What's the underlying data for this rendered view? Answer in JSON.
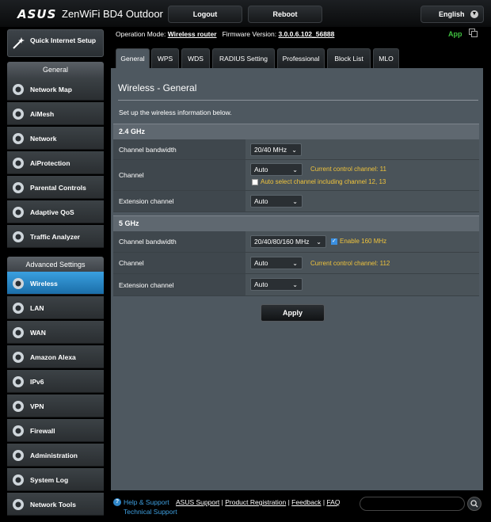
{
  "header": {
    "brand": "ASUS",
    "product": "ZenWiFi BD4 Outdoor",
    "logout_label": "Logout",
    "reboot_label": "Reboot",
    "language": "English"
  },
  "sidebar": {
    "qis_label": "Quick Internet Setup",
    "general_heading": "General",
    "general_items": [
      {
        "label": "Network Map",
        "icon": "network-map-icon"
      },
      {
        "label": "AiMesh",
        "icon": "aimesh-icon"
      },
      {
        "label": "Network",
        "icon": "globe-icon"
      },
      {
        "label": "AiProtection",
        "icon": "shield-icon"
      },
      {
        "label": "Parental Controls",
        "icon": "family-icon"
      },
      {
        "label": "Adaptive QoS",
        "icon": "gauge-icon"
      },
      {
        "label": "Traffic Analyzer",
        "icon": "analyzer-icon"
      }
    ],
    "advanced_heading": "Advanced Settings",
    "advanced_items": [
      {
        "label": "Wireless",
        "icon": "wifi-icon",
        "active": true
      },
      {
        "label": "LAN",
        "icon": "lan-icon"
      },
      {
        "label": "WAN",
        "icon": "wan-globe-icon"
      },
      {
        "label": "Amazon Alexa",
        "icon": "alexa-icon"
      },
      {
        "label": "IPv6",
        "icon": "ipv6-icon"
      },
      {
        "label": "VPN",
        "icon": "vpn-icon"
      },
      {
        "label": "Firewall",
        "icon": "firewall-icon"
      },
      {
        "label": "Administration",
        "icon": "admin-icon"
      },
      {
        "label": "System Log",
        "icon": "system-log-icon"
      },
      {
        "label": "Network Tools",
        "icon": "tools-icon"
      }
    ]
  },
  "infobar": {
    "op_mode_label": "Operation Mode:",
    "op_mode_value": "Wireless router",
    "fw_label": "Firmware Version:",
    "fw_value": "3.0.0.6.102_56888",
    "app_label": "App"
  },
  "tabs": [
    "General",
    "WPS",
    "WDS",
    "RADIUS Setting",
    "Professional",
    "Block List",
    "MLO"
  ],
  "main": {
    "title": "Wireless - General",
    "description": "Set up the wireless information below.",
    "band24": {
      "heading": "2.4 GHz",
      "bandwidth_label": "Channel bandwidth",
      "bandwidth_value": "20/40 MHz",
      "channel_label": "Channel",
      "channel_value": "Auto",
      "channel_hint": "Current control channel: 11",
      "auto_select_label": "Auto select channel including channel 12, 13",
      "auto_select_checked": false,
      "ext_label": "Extension channel",
      "ext_value": "Auto"
    },
    "band5": {
      "heading": "5 GHz",
      "bandwidth_label": "Channel bandwidth",
      "bandwidth_value": "20/40/80/160 MHz",
      "enable160_label": "Enable 160 MHz",
      "enable160_checked": true,
      "channel_label": "Channel",
      "channel_value": "Auto",
      "channel_hint": "Current control channel: 112",
      "ext_label": "Extension channel",
      "ext_value": "Auto"
    },
    "apply_label": "Apply"
  },
  "footer": {
    "help_label": "Help & Support",
    "links": [
      "ASUS Support",
      "Product Registration",
      "Feedback",
      "FAQ"
    ],
    "tech_label": "Technical Support"
  },
  "colors": {
    "accent": "#3aa0e0",
    "hint": "#f0c43c",
    "app": "#3fbf3f",
    "panel": "#4e5860"
  }
}
